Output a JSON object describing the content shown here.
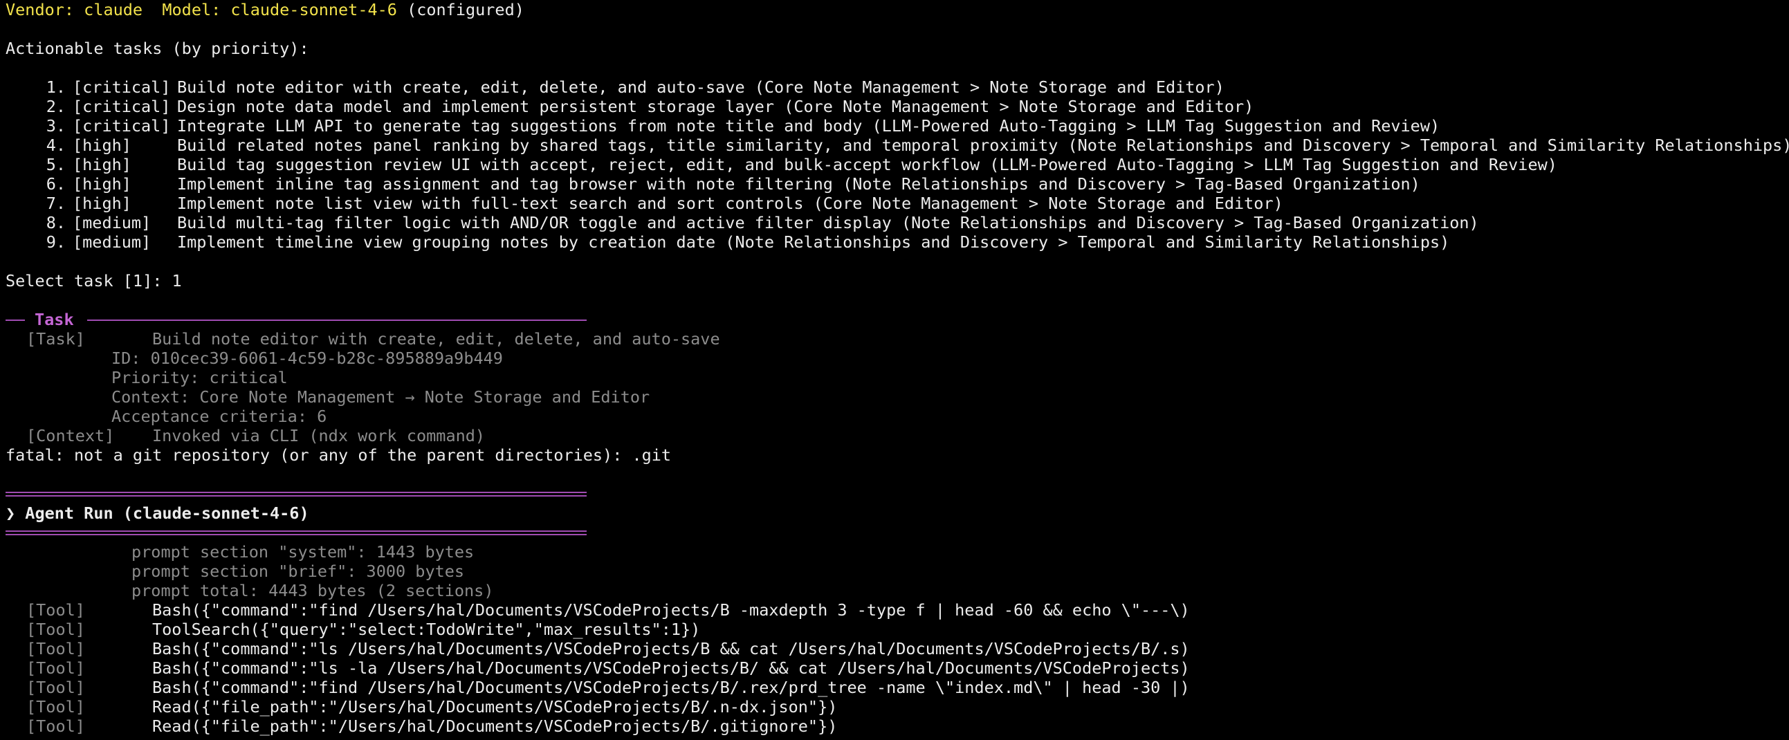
{
  "header": {
    "vendor_label": "Vendor: claude  Model: claude-sonnet-4-6",
    "configured": " (configured)"
  },
  "actionable_heading": "Actionable tasks (by priority):",
  "tasks": [
    {
      "num": "1.",
      "priority": "[critical]",
      "text": "Build note editor with create, edit, delete, and auto-save (Core Note Management > Note Storage and Editor)"
    },
    {
      "num": "2.",
      "priority": "[critical]",
      "text": "Design note data model and implement persistent storage layer (Core Note Management > Note Storage and Editor)"
    },
    {
      "num": "3.",
      "priority": "[critical]",
      "text": "Integrate LLM API to generate tag suggestions from note title and body (LLM-Powered Auto-Tagging > LLM Tag Suggestion and Review)"
    },
    {
      "num": "4.",
      "priority": "[high]",
      "text": "Build related notes panel ranking by shared tags, title similarity, and temporal proximity (Note Relationships and Discovery > Temporal and Similarity Relationships)"
    },
    {
      "num": "5.",
      "priority": "[high]",
      "text": "Build tag suggestion review UI with accept, reject, edit, and bulk-accept workflow (LLM-Powered Auto-Tagging > LLM Tag Suggestion and Review)"
    },
    {
      "num": "6.",
      "priority": "[high]",
      "text": "Implement inline tag assignment and tag browser with note filtering (Note Relationships and Discovery > Tag-Based Organization)"
    },
    {
      "num": "7.",
      "priority": "[high]",
      "text": "Implement note list view with full-text search and sort controls (Core Note Management > Note Storage and Editor)"
    },
    {
      "num": "8.",
      "priority": "[medium]",
      "text": "Build multi-tag filter logic with AND/OR toggle and active filter display (Note Relationships and Discovery > Tag-Based Organization)"
    },
    {
      "num": "9.",
      "priority": "[medium]",
      "text": "Implement timeline view grouping notes by creation date (Note Relationships and Discovery > Temporal and Similarity Relationships)"
    }
  ],
  "select_prompt": "Select task [1]: 1",
  "task_section": {
    "title": "Task",
    "task_tag": "[Task]",
    "task_name": "Build note editor with create, edit, delete, and auto-save",
    "id": "ID: 010cec39-6061-4c59-b28c-895889a9b449",
    "priority": "Priority: critical",
    "context": "Context: Core Note Management → Note Storage and Editor",
    "acceptance": "Acceptance criteria: 6",
    "context_tag": "[Context]",
    "context_text": "Invoked via CLI (ndx work command)"
  },
  "fatal_line": "fatal: not a git repository (or any of the parent directories): .git",
  "agent_run": {
    "title": "❯ Agent Run (claude-sonnet-4-6)",
    "prompt_lines": [
      "prompt section \"system\": 1443 bytes",
      "prompt section \"brief\": 3000 bytes",
      "prompt total: 4443 bytes (2 sections)"
    ],
    "tool_tag": "[Tool]",
    "tool_calls": [
      "Bash({\"command\":\"find /Users/hal/Documents/VSCodeProjects/B -maxdepth 3 -type f | head -60 && echo \\\"---\\)",
      "ToolSearch({\"query\":\"select:TodoWrite\",\"max_results\":1})",
      "Bash({\"command\":\"ls /Users/hal/Documents/VSCodeProjects/B && cat /Users/hal/Documents/VSCodeProjects/B/.s)",
      "Bash({\"command\":\"ls -la /Users/hal/Documents/VSCodeProjects/B/ && cat /Users/hal/Documents/VSCodeProjects)",
      "Bash({\"command\":\"find /Users/hal/Documents/VSCodeProjects/B/.rex/prd_tree -name \\\"index.md\\\" | head -30 |)",
      "Read({\"file_path\":\"/Users/hal/Documents/VSCodeProjects/B/.n-dx.json\"})",
      "Read({\"file_path\":\"/Users/hal/Documents/VSCodeProjects/B/.gitignore\"})"
    ]
  },
  "colors": {
    "background": "#000000",
    "text": "#ececec",
    "header_yellow": "#f2e24b",
    "dim_gray": "#8c8c8c",
    "accent_magenta": "#c466d4",
    "rule_magenta": "#a04cb2"
  }
}
